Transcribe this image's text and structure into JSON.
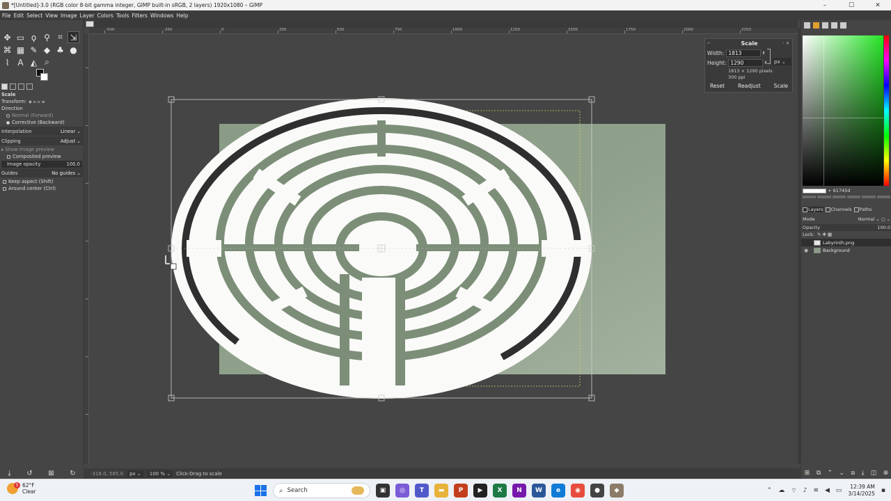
{
  "window": {
    "title": "*[Untitled]-3.0 (RGB color 8-bit gamma integer, GIMP built-in sRGB, 2 layers) 1920x1080 – GIMP",
    "minimize": "–",
    "maximize": "☐",
    "close": "✕"
  },
  "menu": [
    "File",
    "Edit",
    "Select",
    "View",
    "Image",
    "Layer",
    "Colors",
    "Tools",
    "Filters",
    "Windows",
    "Help"
  ],
  "tool_options": {
    "tool_name": "Scale",
    "transform_label": "Transform:",
    "direction_label": "Direction",
    "direction_normal": "Normal (Forward)",
    "direction_corrective": "Corrective (Backward)",
    "interpolation_label": "Interpolation",
    "interpolation_value": "Linear",
    "clipping_label": "Clipping",
    "clipping_value": "Adjust",
    "show_preview": "Show image preview",
    "composited_preview": "Composited preview",
    "image_opacity_label": "Image opacity",
    "image_opacity_value": "100.0",
    "guides_label": "Guides",
    "guides_value": "No guides",
    "keep_aspect": "Keep aspect (Shift)",
    "around_center": "Around center (Ctrl)"
  },
  "rulers": {
    "top": [
      "-500",
      "-250",
      "0",
      "250",
      "500",
      "750",
      "1000",
      "1250",
      "1500",
      "1750",
      "2000",
      "2250"
    ]
  },
  "status": {
    "coords": "-318.0, 585.0",
    "unit": "px",
    "zoom": "100 %",
    "message": "Click-Drag to scale"
  },
  "scale_dialog": {
    "title": "Scale",
    "width_label": "Width:",
    "width_value": "1813",
    "height_label": "Height:",
    "height_value": "1290",
    "unit": "px",
    "size_info": "1813 × 1290 pixels",
    "ppi_info": "300 ppi",
    "reset": "Reset",
    "readjust": "Readjust",
    "scale": "Scale"
  },
  "colors": {
    "hex_value": "61745d",
    "canvas_bg": "#454545",
    "image_green": "#8a9c86",
    "maze_green": "#7c8e78"
  },
  "layers_panel": {
    "tab_layers": "Layers",
    "tab_channels": "Channels",
    "tab_paths": "Paths",
    "mode_label": "Mode",
    "mode_value": "Normal",
    "opacity_label": "Opacity",
    "opacity_value": "100.0",
    "lock_label": "Lock:",
    "layers": [
      {
        "name": "Labyrinth.png",
        "visible": false
      },
      {
        "name": "Background",
        "visible": true
      }
    ]
  },
  "taskbar": {
    "weather_temp": "62°F",
    "weather_desc": "Clear",
    "weather_badge": "5",
    "search_placeholder": "Search",
    "time": "12:39 AM",
    "date": "3/14/2025"
  }
}
